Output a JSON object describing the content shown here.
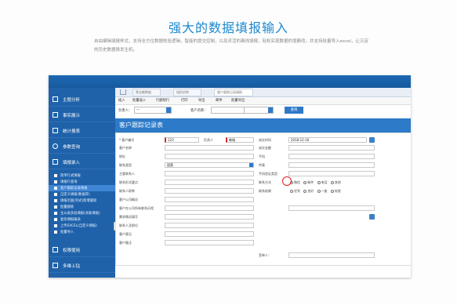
{
  "headline": "强大的数据填报输入",
  "description": "自由编辑填报样式，支持全方位数据校验逻辑，智能的提交控制，以及灵活的离线填报，轻松实现数据的增删改，并支持批量导入excel，让沉淀的历史数据焕发生机。",
  "sidebar": {
    "items": [
      {
        "label": "主题分析"
      },
      {
        "label": "事实展示"
      },
      {
        "label": "统计报表"
      },
      {
        "label": "参数查询"
      },
      {
        "label": "填报录入"
      },
      {
        "label": "权限使用"
      },
      {
        "label": "多维上钻"
      }
    ],
    "subitems": [
      {
        "label": "简单行式填报"
      },
      {
        "label": "填报行查询"
      },
      {
        "label": "客户跟踪记录填报"
      },
      {
        "label": "自定义填报(数据库)"
      },
      {
        "label": "填报页面(列式)新增删除"
      },
      {
        "label": "批量删除"
      },
      {
        "label": "主从表多层填报(关联填报)"
      },
      {
        "label": "复杂填报报表"
      },
      {
        "label": "上传EXCEL(自定义填报)"
      },
      {
        "label": "批量导入"
      }
    ],
    "collapse_glyph": "‹"
  },
  "tabs": [
    "营业额数据",
    "组织机构",
    "客户跟踪记录填报"
  ],
  "toolbar": [
    "插入",
    "批量插入",
    "行删除行",
    "打印",
    "导出",
    "邮件",
    "批量导出"
  ],
  "filter": {
    "label1": "负责人：",
    "value1": "—",
    "label2": "客户名称：",
    "query_button": "查询"
  },
  "form": {
    "title": "客户跟踪记录表",
    "fields_left": [
      "* 客户编号",
      "客户名称",
      "地址",
      "联系类型",
      "主要联系人",
      "联系形式要点",
      "联系人职称",
      "客户公司概况",
      "客户在公司所有联系历程",
      "需求情况填写",
      "联系人及职位",
      "客户意见",
      "客户备注"
    ],
    "customer_no": "123",
    "owner_label": "负责人",
    "owner_value": "韩城",
    "contact_type_value": "国营",
    "fields_right": [
      "成交时间",
      "成交金额",
      "手机",
      "传真",
      "手机验证类型",
      "联系方式",
      "联系结果"
    ],
    "deal_date": "2018-12-16",
    "radio_row1": [
      "微信",
      "邮件",
      "电话",
      "其他"
    ],
    "radio_row2": [
      "优秀",
      "良好",
      "一般",
      "较差"
    ],
    "signer_label": "签单人："
  }
}
